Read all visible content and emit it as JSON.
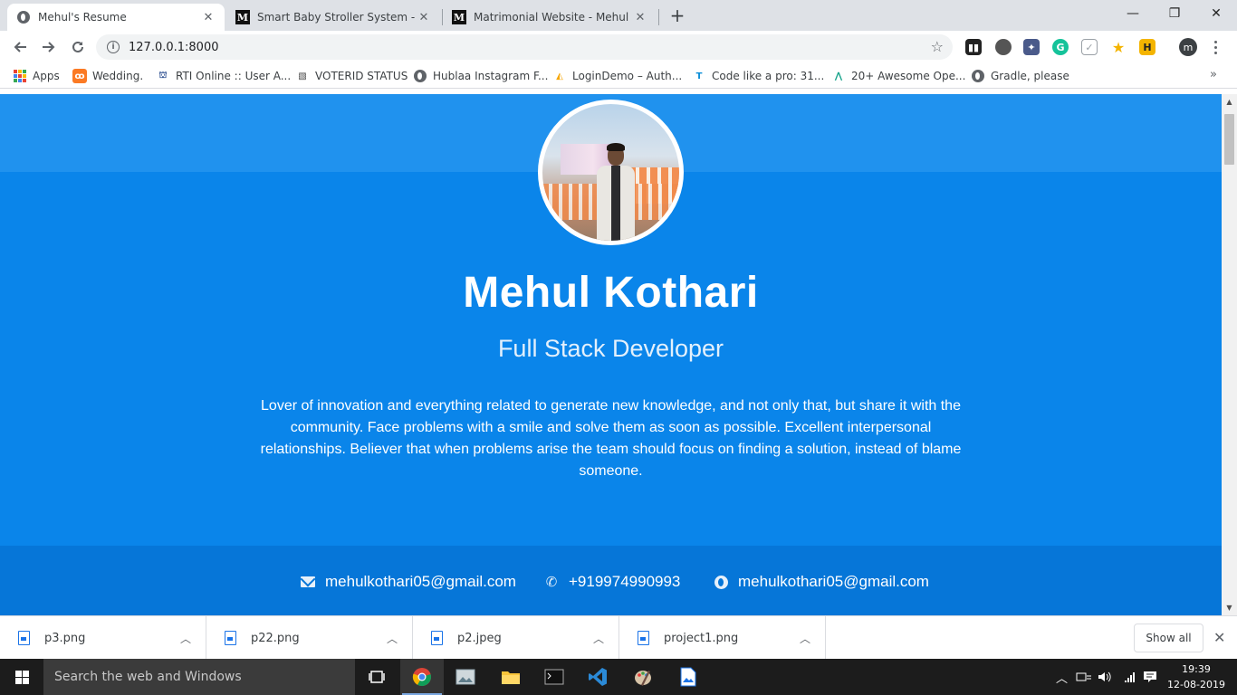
{
  "browser": {
    "tabs": [
      {
        "title": "Mehul's Resume",
        "icon": "globe-icon",
        "active": true
      },
      {
        "title": "Smart Baby Stroller System - Meh",
        "icon": "medium-icon",
        "active": false
      },
      {
        "title": "Matrimonial Website - Mehul Kot",
        "icon": "medium-icon",
        "active": false
      }
    ],
    "new_tab_icon": "+",
    "window_controls": {
      "minimize": "—",
      "maximize": "❐",
      "close": "✕"
    },
    "address": "127.0.0.1:8000",
    "profile_initial": "m"
  },
  "bookmarks": [
    {
      "label": "Apps",
      "icon": "apps-grid-icon"
    },
    {
      "label": "Wedding.",
      "icon": "xampp-icon"
    },
    {
      "label": "RTI Online :: User A...",
      "icon": "rti-icon"
    },
    {
      "label": "VOTERID STATUS",
      "icon": "voterid-icon"
    },
    {
      "label": "Hublaa Instagram F...",
      "icon": "globe-icon"
    },
    {
      "label": "LoginDemo – Auth...",
      "icon": "auth-icon"
    },
    {
      "label": "Code like a pro: 31...",
      "icon": "code-icon"
    },
    {
      "label": "20+ Awesome Ope...",
      "icon": "awesome-icon"
    },
    {
      "label": "Gradle, please",
      "icon": "globe-icon"
    }
  ],
  "page": {
    "name": "Mehul Kothari",
    "role": "Full Stack Developer",
    "bio": "Lover of innovation and everything related to generate new knowledge, and not only that, but share it with the community. Face problems with a smile and solve them as soon as possible. Excellent interpersonal relationships. Believer that when problems arise the team should focus on finding a solution, instead of blame someone.",
    "contacts": [
      {
        "type": "email",
        "icon": "envelope-icon",
        "value": "mehulkothari05@gmail.com"
      },
      {
        "type": "phone",
        "icon": "phone-icon",
        "value": "+919974990993"
      },
      {
        "type": "website",
        "icon": "globe-icon",
        "value": "mehulkothari05@gmail.com"
      }
    ],
    "colors": {
      "hero": "#0a85ea",
      "hero_band": "#2092ee",
      "contact_bar": "#0676d8"
    }
  },
  "downloads": {
    "items": [
      "p3.png",
      "p22.png",
      "p2.jpeg",
      "project1.png"
    ],
    "show_all": "Show all"
  },
  "taskbar": {
    "search_placeholder": "Search the web and Windows",
    "time": "19:39",
    "date": "12-08-2019"
  }
}
